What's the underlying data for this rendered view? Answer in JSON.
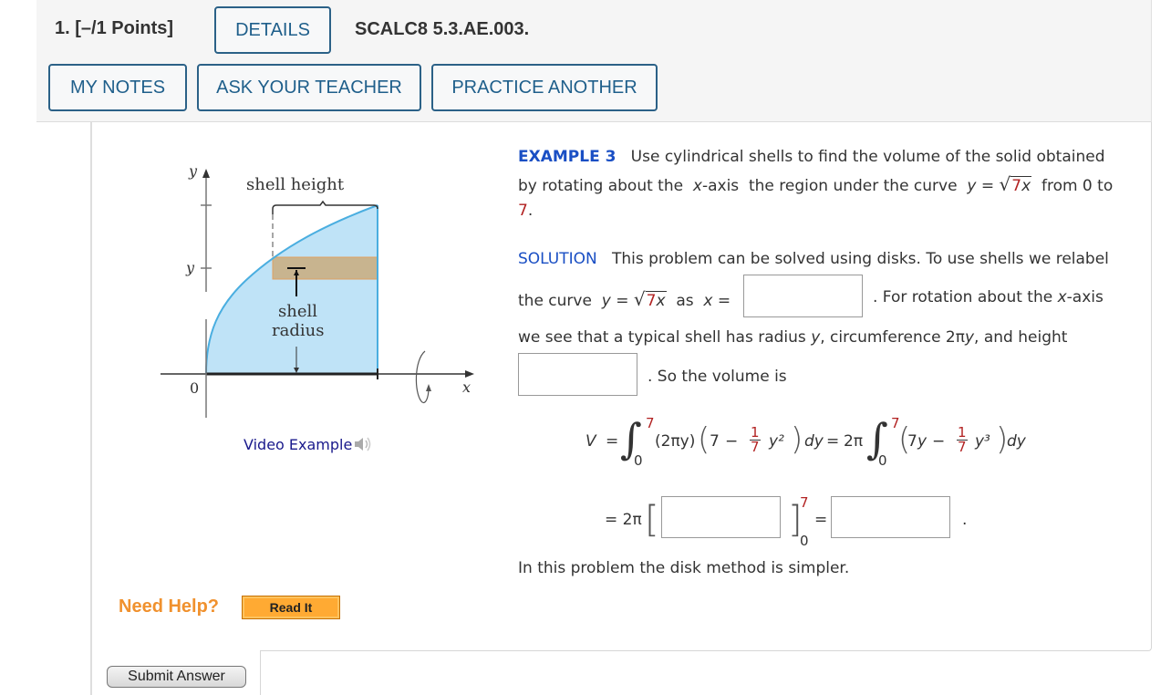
{
  "header": {
    "question_label": "1.  [–/1 Points]",
    "details_button": "DETAILS",
    "question_code": "SCALC8 5.3.AE.003.",
    "my_notes_button": "MY NOTES",
    "ask_teacher_button": "ASK YOUR TEACHER",
    "practice_button": "PRACTICE ANOTHER"
  },
  "figure": {
    "y_axis_label": "y",
    "x_axis_label": "x",
    "origin_label": "0",
    "y_tick_label": "y",
    "shell_height_label": "shell height",
    "shell_radius_line1": "shell",
    "shell_radius_line2": "radius"
  },
  "video_example": {
    "label": "Video Example",
    "icon": "speaker-icon"
  },
  "example": {
    "label": "EXAMPLE 3",
    "line1": "Use cylindrical shells to find the volume of the solid obtained",
    "line2_a": "by rotating about the",
    "line2_xaxis": "x",
    "line2_axis_suffix": "-axis",
    "line2_b": "the region under the curve",
    "curve_y": "y",
    "equals": "=",
    "sqrt_coeff": "7",
    "sqrt_var": "x",
    "line2_c": "from 0 to",
    "upper_limit": "7",
    "period": "."
  },
  "solution": {
    "label": "SOLUTION",
    "line1": "This problem can be solved using disks. To use shells we relabel",
    "line2_a": "the curve",
    "curve_y": "y",
    "equals": "=",
    "sqrt_coeff": "7",
    "sqrt_var": "x",
    "line2_as": "as",
    "line2_x": "x",
    "line2_b": ". For rotation about the",
    "line2_xaxis": "x",
    "line2_axis_suffix": "-axis",
    "line3": "we see that a typical shell has radius",
    "line3_y": "y",
    "line3_b": ", circumference 2π",
    "line3_y2": "y",
    "line3_c": ", and height",
    "line4": ". So the volume is",
    "closing": "In this problem the disk method is simpler."
  },
  "answers": {
    "x_of_y": "",
    "height": "",
    "antiderivative": "",
    "volume": ""
  },
  "integral": {
    "V": "V",
    "eq": "=",
    "upper": "7",
    "lower": "0",
    "factor": "(2πy)",
    "seven": "7",
    "minus": "−",
    "frac_num": "1",
    "frac_den": "7",
    "y_sq": "y²",
    "dy": "dy",
    "two_pi": "2π",
    "seven_y": "7",
    "y_var": "y",
    "y_cube": "y³",
    "row2_prefix": "= 2π",
    "row2_upper": "7",
    "row2_lower": "0",
    "row2_eq": "=",
    "row2_period": "."
  },
  "help": {
    "need_help": "Need Help?",
    "read_it": "Read It"
  },
  "footer": {
    "submit": "Submit Answer"
  },
  "colors": {
    "button_border": "#2b6187",
    "example_blue": "#1a4fc4",
    "red_value": "#b22222",
    "region_fill": "#bfe3f7",
    "shell_fill": "#c8b48f",
    "need_help_orange": "#f0912e",
    "read_it_bg": "#ffaa33"
  }
}
